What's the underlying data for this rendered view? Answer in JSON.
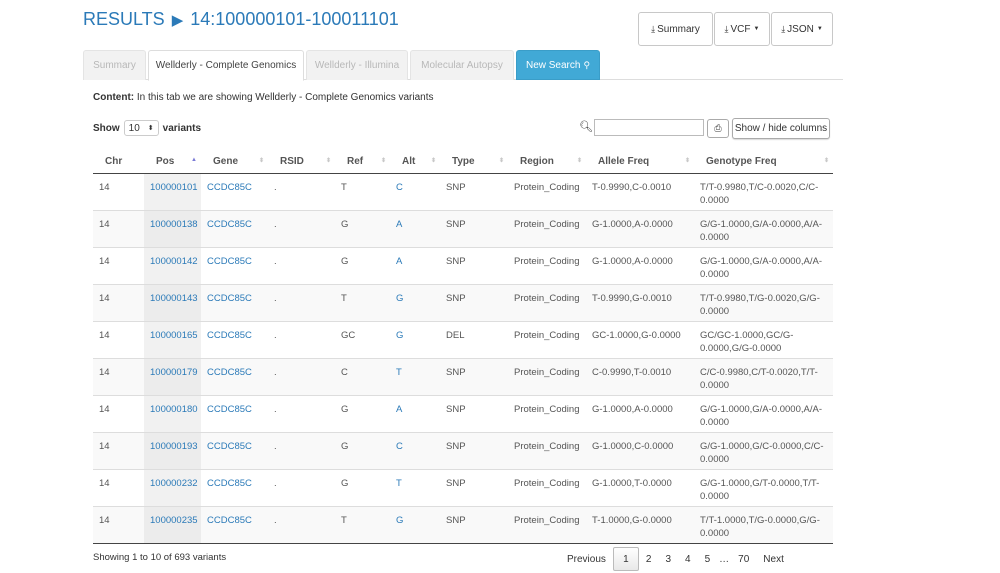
{
  "title": {
    "prefix": "RESULTS",
    "arrow": "▶",
    "region": "14:100000101-100011101"
  },
  "downloads": [
    {
      "label": "Summary",
      "icon": "download-icon",
      "caret": false
    },
    {
      "label": "VCF",
      "icon": "download-icon",
      "caret": true
    },
    {
      "label": "JSON",
      "icon": "download-icon",
      "caret": true
    }
  ],
  "tabs": [
    {
      "label": "Summary",
      "state": "disabled"
    },
    {
      "label": "Wellderly - Complete Genomics",
      "state": "active"
    },
    {
      "label": "Wellderly - Illumina",
      "state": "disabled"
    },
    {
      "label": "Molecular Autopsy",
      "state": "disabled"
    },
    {
      "label": "New Search",
      "state": "primary",
      "icon": "search-icon"
    }
  ],
  "content": {
    "label": "Content:",
    "text": " In this tab we are showing Wellderly - Complete Genomics variants"
  },
  "length": {
    "show": "Show",
    "value": "10",
    "suffix": "variants"
  },
  "search": {
    "value": ""
  },
  "toolbar": {
    "cols_label": "Show / hide columns"
  },
  "table": {
    "headers": [
      "Chr",
      "Pos",
      "Gene",
      "RSID",
      "Ref",
      "Alt",
      "Type",
      "Region",
      "Allele Freq",
      "Genotype Freq"
    ],
    "rows": [
      [
        "14",
        "100000101",
        "CCDC85C",
        ".",
        "T",
        "C",
        "SNP",
        "Protein_Coding",
        "T-0.9990,C-0.0010",
        "T/T-0.9980,T/C-0.0020,C/C-0.0000"
      ],
      [
        "14",
        "100000138",
        "CCDC85C",
        ".",
        "G",
        "A",
        "SNP",
        "Protein_Coding",
        "G-1.0000,A-0.0000",
        "G/G-1.0000,G/A-0.0000,A/A-0.0000"
      ],
      [
        "14",
        "100000142",
        "CCDC85C",
        ".",
        "G",
        "A",
        "SNP",
        "Protein_Coding",
        "G-1.0000,A-0.0000",
        "G/G-1.0000,G/A-0.0000,A/A-0.0000"
      ],
      [
        "14",
        "100000143",
        "CCDC85C",
        ".",
        "T",
        "G",
        "SNP",
        "Protein_Coding",
        "T-0.9990,G-0.0010",
        "T/T-0.9980,T/G-0.0020,G/G-0.0000"
      ],
      [
        "14",
        "100000165",
        "CCDC85C",
        ".",
        "GC",
        "G",
        "DEL",
        "Protein_Coding",
        "GC-1.0000,G-0.0000",
        "GC/GC-1.0000,GC/G-0.0000,G/G-0.0000"
      ],
      [
        "14",
        "100000179",
        "CCDC85C",
        ".",
        "C",
        "T",
        "SNP",
        "Protein_Coding",
        "C-0.9990,T-0.0010",
        "C/C-0.9980,C/T-0.0020,T/T-0.0000"
      ],
      [
        "14",
        "100000180",
        "CCDC85C",
        ".",
        "G",
        "A",
        "SNP",
        "Protein_Coding",
        "G-1.0000,A-0.0000",
        "G/G-1.0000,G/A-0.0000,A/A-0.0000"
      ],
      [
        "14",
        "100000193",
        "CCDC85C",
        ".",
        "G",
        "C",
        "SNP",
        "Protein_Coding",
        "G-1.0000,C-0.0000",
        "G/G-1.0000,G/C-0.0000,C/C-0.0000"
      ],
      [
        "14",
        "100000232",
        "CCDC85C",
        ".",
        "G",
        "T",
        "SNP",
        "Protein_Coding",
        "G-1.0000,T-0.0000",
        "G/G-1.0000,G/T-0.0000,T/T-0.0000"
      ],
      [
        "14",
        "100000235",
        "CCDC85C",
        ".",
        "T",
        "G",
        "SNP",
        "Protein_Coding",
        "T-1.0000,G-0.0000",
        "T/T-1.0000,T/G-0.0000,G/G-0.0000"
      ]
    ]
  },
  "footer": {
    "info": "Showing 1 to 10 of 693 variants",
    "previous": "Previous",
    "pages": [
      "1",
      "2",
      "3",
      "4",
      "5",
      "…",
      "70"
    ],
    "current": "1",
    "next": "Next"
  }
}
